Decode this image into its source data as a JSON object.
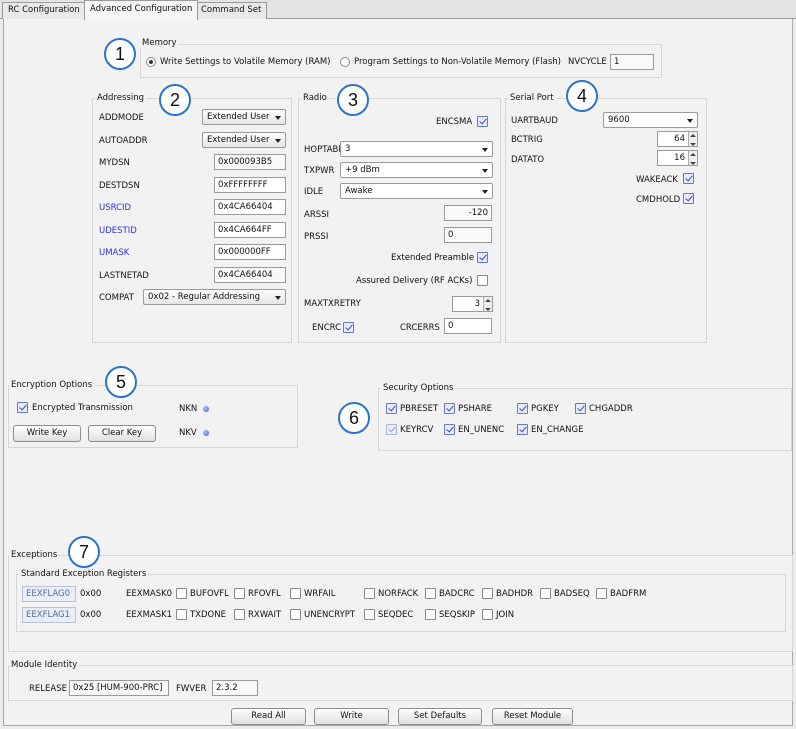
{
  "tabs": [
    "RC Configuration",
    "Advanced Configuration",
    "Command Set"
  ],
  "memory": {
    "title": "Memory",
    "option_ram": "Write Settings to Volatile Memory (RAM)",
    "option_flash": "Program Settings to Non-Volatile Memory (Flash)",
    "nvcycle_label": "NVCYCLE",
    "nvcycle_value": "1"
  },
  "addressing": {
    "title": "Addressing",
    "addrmode_label": "ADDMODE",
    "addrmode_value": "Extended User",
    "autoaddr_label": "AUTOADDR",
    "autoaddr_value": "Extended User",
    "mydsn_label": "MYDSN",
    "mydsn_value": "0x000093B5",
    "destdsn_label": "DESTDSN",
    "destdsn_value": "0xFFFFFFFF",
    "usrcid_label": "USRCID",
    "usrcid_value": "0x4CA66404",
    "udestid_label": "UDESTID",
    "udestid_value": "0x4CA664FF",
    "umask_label": "UMASK",
    "umask_value": "0x000000FF",
    "lastnetad_label": "LASTNETAD",
    "lastnetad_value": "0x4CA66404",
    "compat_label": "COMPAT",
    "compat_value": "0x02 - Regular Addressing"
  },
  "radio": {
    "title": "Radio",
    "encsma_label": "ENCSMA",
    "hoptable_label": "HOPTABLE",
    "hoptable_value": "3",
    "txpwr_label": "TXPWR",
    "txpwr_value": "+9 dBm",
    "idle_label": "IDLE",
    "idle_value": "Awake",
    "arssi_label": "ARSSI",
    "arssi_value": "-120",
    "prssi_label": "PRSSI",
    "prssi_value": "0",
    "ext_preamble_label": "Extended Preamble",
    "assured_label": "Assured Delivery (RF ACKs)",
    "maxtxretry_label": "MAXTXRETRY",
    "maxtxretry_value": "3",
    "encrc_label": "ENCRC",
    "crcerrs_label": "CRCERRS",
    "crcerrs_value": "0"
  },
  "serial": {
    "title": "Serial Port",
    "uartbaud_label": "UARTBAUD",
    "uartbaud_value": "9600",
    "bctrig_label": "BCTRIG",
    "bctrig_value": "64",
    "datato_label": "DATATO",
    "datato_value": "16",
    "wakeack_label": "WAKEACK",
    "cmdhold_label": "CMDHOLD"
  },
  "encryption": {
    "title": "Encryption Options",
    "encrypted_label": "Encrypted Transmission",
    "nkn_label": "NKN",
    "nkv_label": "NKV",
    "write_key": "Write Key",
    "clear_key": "Clear Key"
  },
  "security": {
    "title": "Security Options",
    "pbreset": "PBRESET",
    "pshare": "PSHARE",
    "pgkey": "PGKEY",
    "chgaddr": "CHGADDR",
    "keyrcv": "KEYRCV",
    "en_unenc": "EN_UNENC",
    "en_change": "EN_CHANGE"
  },
  "exceptions": {
    "title": "Exceptions",
    "sub_title": "Standard Exception Registers",
    "flag0_label": "EEXFLAG0",
    "flag0_value": "0x00",
    "flag1_label": "EEXFLAG1",
    "flag1_value": "0x00",
    "mask0_label": "EEXMASK0",
    "mask1_label": "EEXMASK1",
    "row0": [
      "BUFOVFL",
      "RFOVFL",
      "WRFAIL",
      "NORFACK",
      "BADCRC",
      "BADHDR",
      "BADSEQ",
      "BADFRM"
    ],
    "row1": [
      "TXDONE",
      "RXWAIT",
      "UNENCRYPT",
      "SEQDEC",
      "SEQSKIP",
      "JOIN"
    ]
  },
  "identity": {
    "title": "Module Identity",
    "release_label": "RELEASE",
    "release_value": "0x25 [HUM-900-PRC]",
    "fwver_label": "FWVER",
    "fwver_value": "2.3.2"
  },
  "buttons": {
    "read_all": "Read All",
    "write": "Write",
    "set_defaults": "Set Defaults",
    "reset_module": "Reset Module"
  },
  "callouts": [
    "1",
    "2",
    "3",
    "4",
    "5",
    "6",
    "7"
  ],
  "colors": {
    "callout_ring": "#2b74c7",
    "blue_label": "#2a32d6",
    "led": "#3b63d6"
  }
}
